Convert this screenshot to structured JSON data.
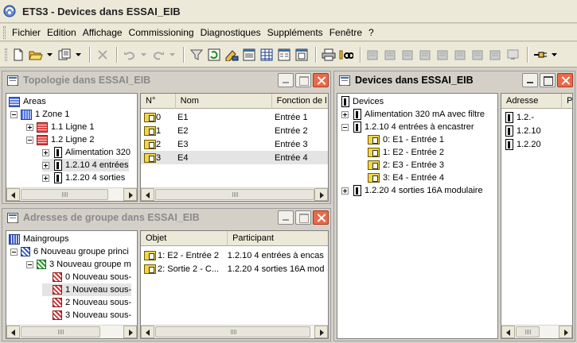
{
  "app": {
    "title": "ETS3 - Devices dans ESSAI_EIB"
  },
  "menu": [
    "Fichier",
    "Edition",
    "Affichage",
    "Commissioning",
    "Diagnostiques",
    "Suppléments",
    "Fenêtre",
    "?"
  ],
  "topology": {
    "title": "Topologie dans ESSAI_EIB",
    "tree": [
      "Areas",
      "1 Zone 1",
      "1.1 Ligne 1",
      "1.2 Ligne 2",
      "Alimentation 320",
      "1.2.10 4 entrées",
      "1.2.20 4 sorties"
    ],
    "columns": [
      "N°",
      "Nom",
      "Fonction de l"
    ],
    "rows": [
      [
        "0",
        "E1",
        "Entrée 1"
      ],
      [
        "1",
        "E2",
        "Entrée 2"
      ],
      [
        "2",
        "E3",
        "Entrée 3"
      ],
      [
        "3",
        "E4",
        "Entrée 4"
      ]
    ]
  },
  "groups": {
    "title": "Adresses de groupe dans ESSAI_EIB",
    "tree": [
      "Maingroups",
      "6 Nouveau groupe princi",
      "3 Nouveau groupe m",
      "0 Nouveau sous-",
      "1 Nouveau sous-",
      "2 Nouveau sous-",
      "3 Nouveau sous-"
    ],
    "columns": [
      "Objet",
      "Participant"
    ],
    "rows": [
      [
        "1: E2 - Entrée 2",
        "1.2.10 4 entrées à encas"
      ],
      [
        "2: Sortie 2 - C...",
        "1.2.20 4 sorties 16A mod"
      ]
    ]
  },
  "devices": {
    "title": "Devices dans ESSAI_EIB",
    "tree": [
      "Devices",
      "Alimentation 320 mA avec filtre",
      "1.2.10 4 entrées à encastrer",
      "0: E1 - Entrée 1",
      "1: E2 - Entrée 2",
      "2: E3 - Entrée 3",
      "3: E4 - Entrée 4",
      "1.2.20 4 sorties 16A modulaire"
    ],
    "columns": [
      "Adresse",
      "P"
    ],
    "rows": [
      "1.2.-",
      "1.2.10",
      "1.2.20"
    ]
  }
}
